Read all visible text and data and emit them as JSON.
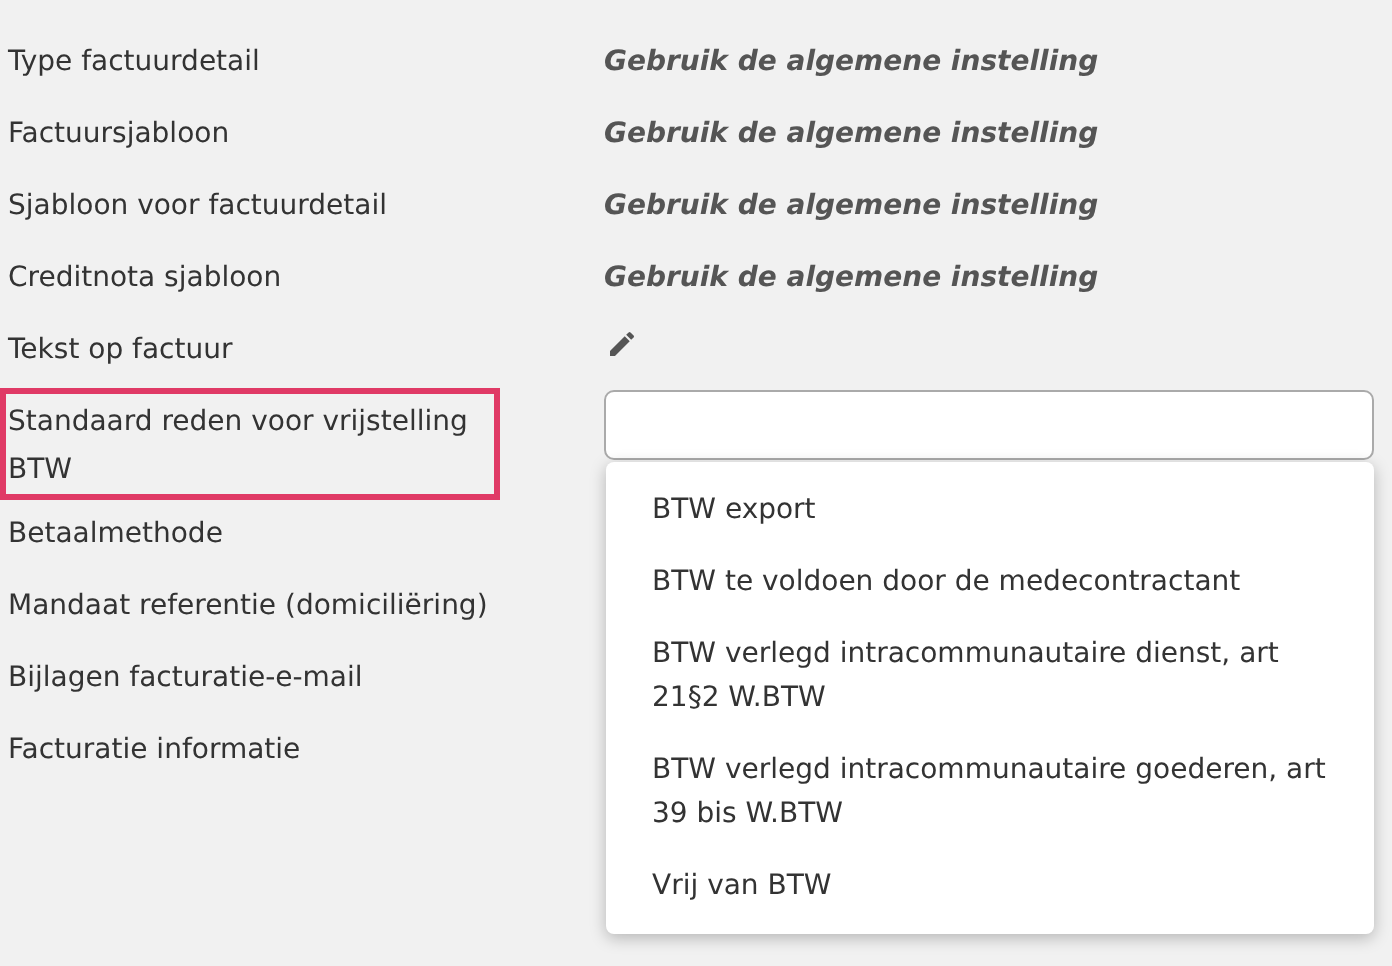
{
  "settings": [
    {
      "label": "Type factuurdetail",
      "kind": "text",
      "value": "Gebruik de algemene instelling"
    },
    {
      "label": "Factuursjabloon",
      "kind": "text",
      "value": "Gebruik de algemene instelling"
    },
    {
      "label": "Sjabloon voor factuurdetail",
      "kind": "text",
      "value": "Gebruik de algemene instelling"
    },
    {
      "label": "Creditnota sjabloon",
      "kind": "text",
      "value": "Gebruik de algemene instelling"
    },
    {
      "label": "Tekst op factuur",
      "kind": "edit"
    },
    {
      "label": "Standaard reden voor vrijstelling BTW",
      "kind": "select",
      "highlighted": true
    },
    {
      "label": "Betaalmethode",
      "kind": "hidden"
    },
    {
      "label": "Mandaat referentie (domiciliëring)",
      "kind": "hidden"
    },
    {
      "label": "Bijlagen facturatie-e-mail",
      "kind": "hidden"
    },
    {
      "label": "Facturatie informatie",
      "kind": "hidden"
    }
  ],
  "dropdown": {
    "options": [
      {
        "label": "BTW export"
      },
      {
        "label": "BTW te voldoen door de medecontractant"
      },
      {
        "label": "BTW verlegd intracommunautaire dienst, art 21§2 W.BTW"
      },
      {
        "label": "BTW verlegd intracommunautaire goederen, art 39 bis W.BTW"
      },
      {
        "label": "Vrij van BTW"
      }
    ]
  }
}
